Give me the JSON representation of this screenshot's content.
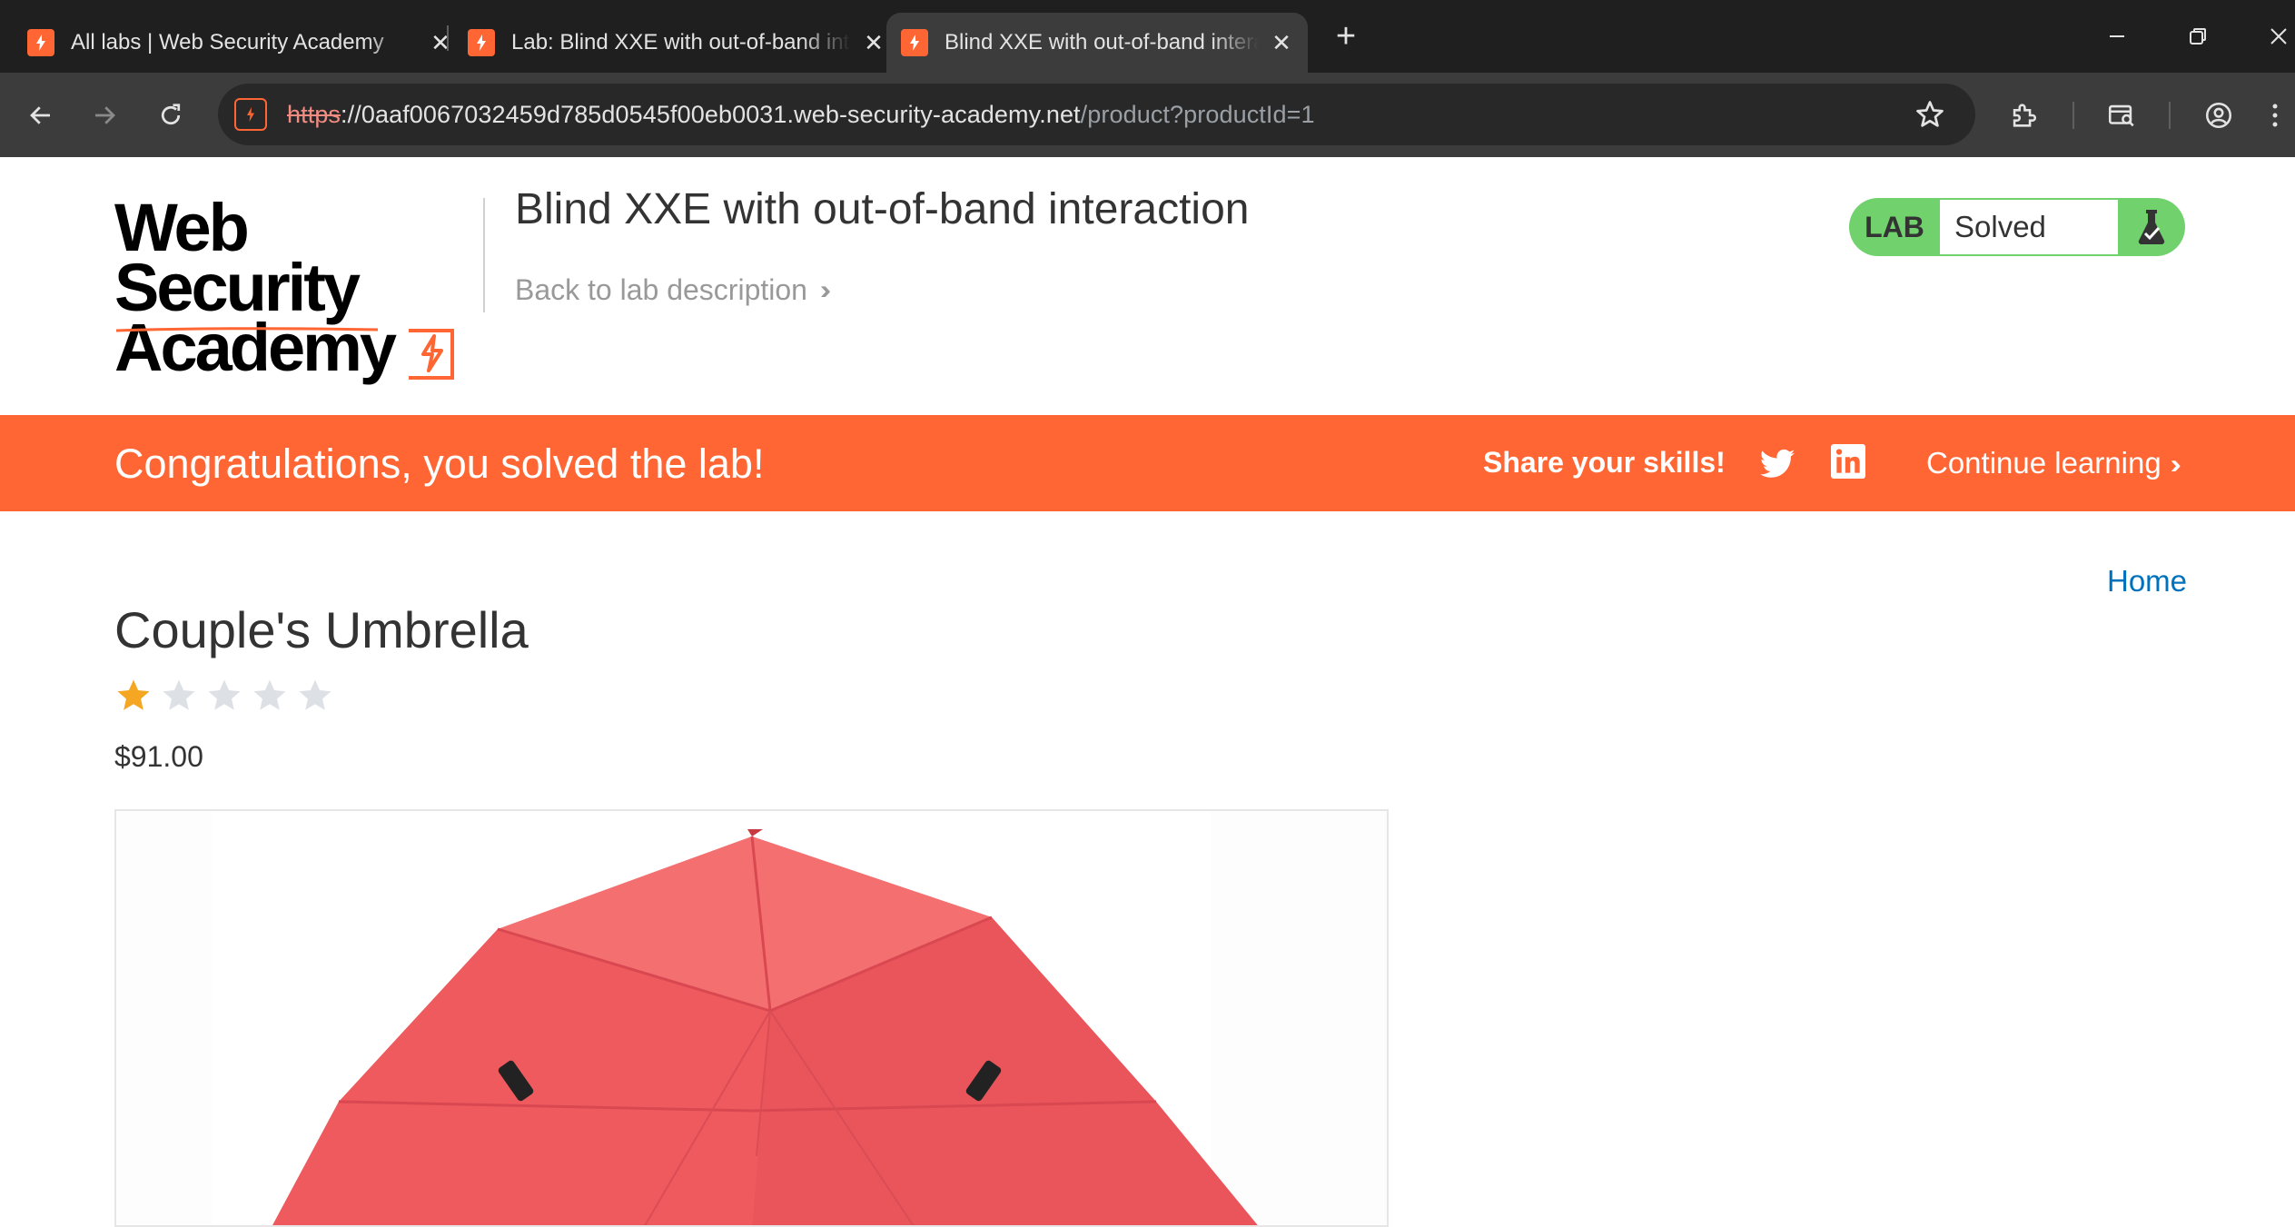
{
  "browser": {
    "tabs": [
      {
        "title": "All labs | Web Security Academy",
        "active": false
      },
      {
        "title": "Lab: Blind XXE with out-of-band interaction",
        "active": false
      },
      {
        "title": "Blind XXE with out-of-band interaction",
        "active": true
      }
    ],
    "url": {
      "scheme": "https",
      "host": "://0aaf0067032459d785d0545f00eb0031.web-security-academy.net",
      "path": "/product?productId=1"
    }
  },
  "header": {
    "logo_line1": "Web Security",
    "logo_line2": "Academy",
    "lab_title": "Blind XXE with out-of-band interaction",
    "back_link": "Back to lab description",
    "lab_badge_label": "LAB",
    "lab_status": "Solved"
  },
  "banner": {
    "message": "Congratulations, you solved the lab!",
    "share": "Share your skills!",
    "continue": "Continue learning"
  },
  "product": {
    "home_link": "Home",
    "title": "Couple's Umbrella",
    "rating": 1,
    "rating_max": 5,
    "price": "$91.00"
  },
  "colors": {
    "brand_orange": "#ff6633",
    "lab_green": "#70d16d",
    "link_blue": "#0071bc",
    "star_gold": "#f5a623",
    "star_empty": "#dde1e6"
  },
  "icons": [
    "back-icon",
    "forward-icon",
    "reload-icon",
    "site-info-icon",
    "bookmark-star-icon",
    "extensions-icon",
    "reading-mode-icon",
    "profile-icon",
    "menu-icon",
    "twitter-icon",
    "linkedin-icon",
    "flask-icon"
  ]
}
